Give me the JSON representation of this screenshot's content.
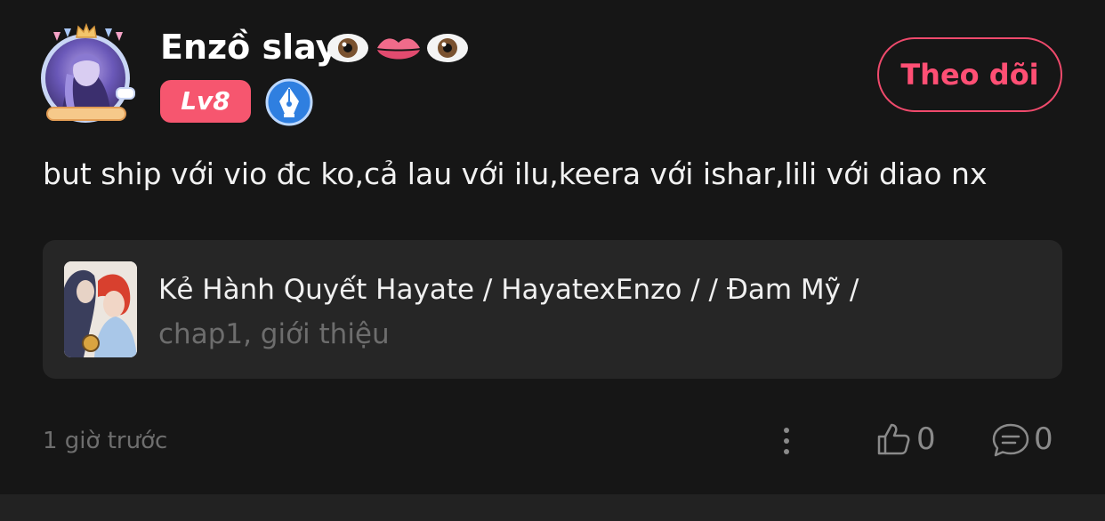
{
  "user": {
    "name": "Enzồ slay",
    "name_emojis": [
      "eye-emoji",
      "lips-emoji",
      "eye-emoji"
    ],
    "level": "Lv8",
    "badge_icon": "pen-nib-icon"
  },
  "follow_button": {
    "label": "Theo dõi"
  },
  "post": {
    "text": "but ship với vio đc ko,cả lau với ilu,keera với ishar,lili với diao nx",
    "time": "1 giờ trước"
  },
  "story": {
    "title": "Kẻ Hành Quyết Hayate / HayatexEnzo / / Đam Mỹ /",
    "subtitle": "chap1, giới thiệu"
  },
  "actions": {
    "like_count": "0",
    "comment_count": "0",
    "more_icon": "vertical-ellipsis-icon",
    "like_icon": "thumbs-up-icon",
    "comment_icon": "comment-bubble-icon"
  },
  "colors": {
    "background": "#161616",
    "accent": "#ff4f74",
    "level_badge": "#f6566f",
    "card": "#262626",
    "muted_text": "#6e6e6e"
  }
}
